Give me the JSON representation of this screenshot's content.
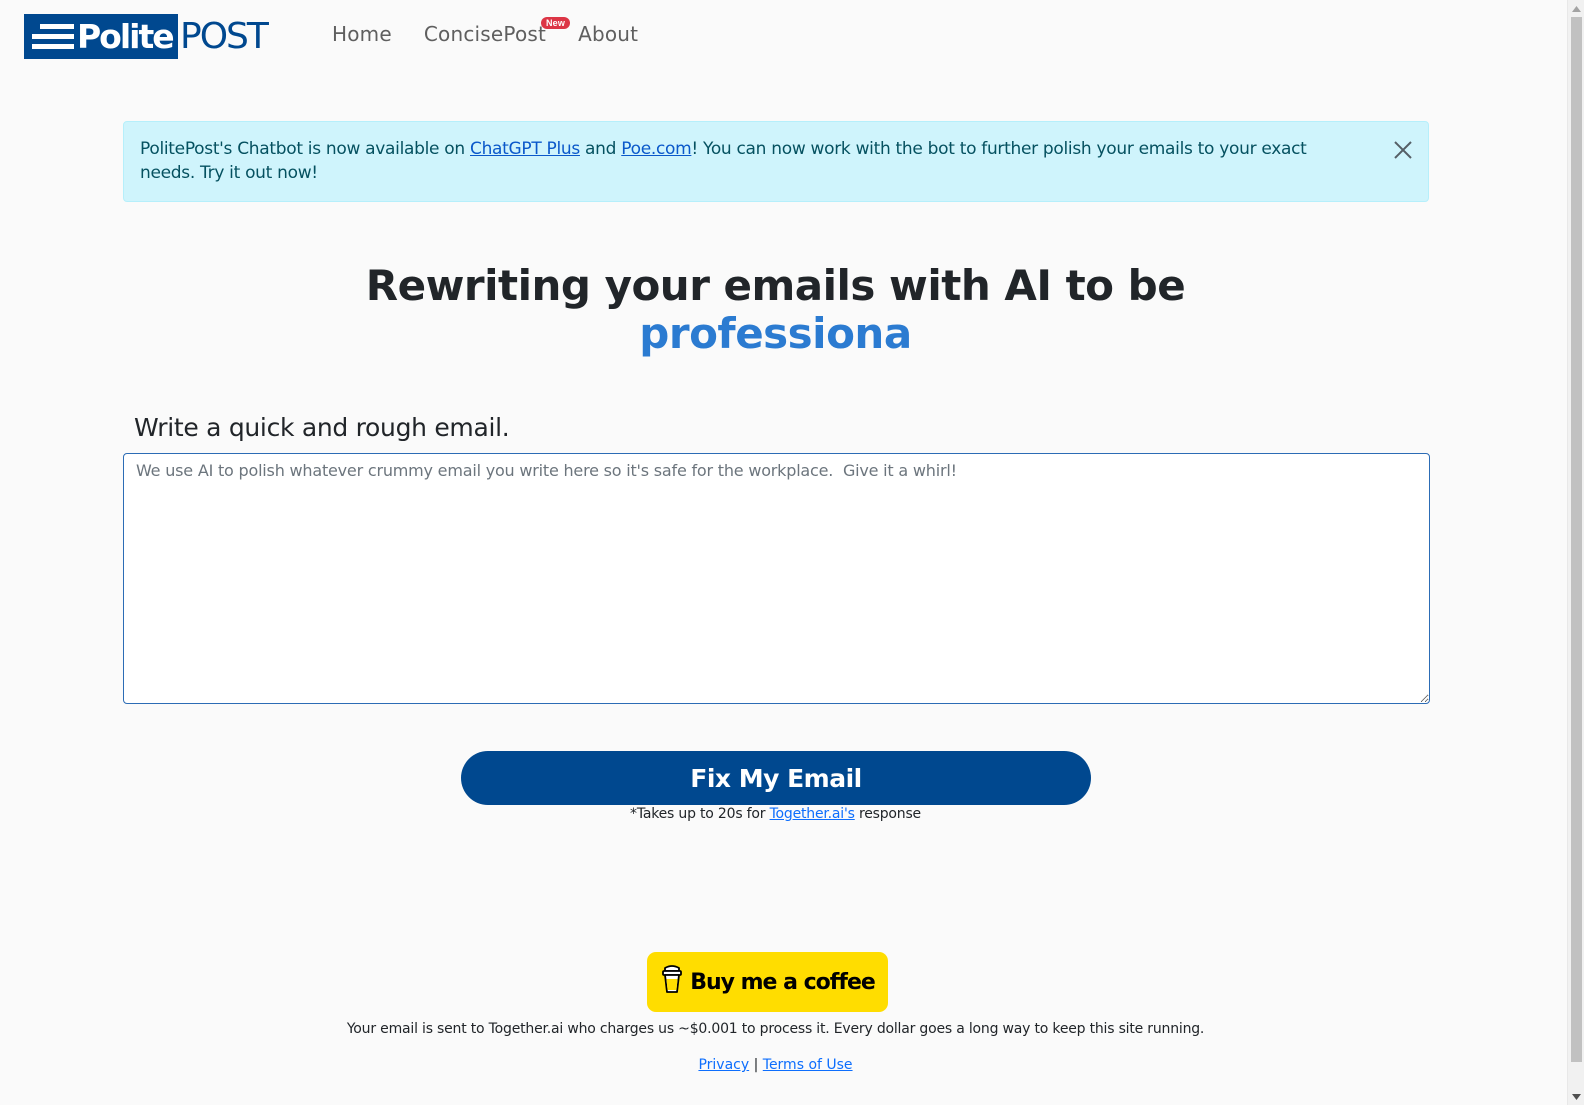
{
  "header": {
    "logo": {
      "part1": "Polite",
      "part2": "POST"
    },
    "nav": [
      {
        "label": "Home"
      },
      {
        "label": "ConcisePost",
        "badge": "New"
      },
      {
        "label": "About"
      }
    ]
  },
  "alert": {
    "text_before": "PolitePost's Chatbot is now available on ",
    "link1": "ChatGPT Plus",
    "text_between": " and ",
    "link2": "Poe.com",
    "text_after": "! You can now work with the bot to further polish your emails to your exact needs. Try it out now!",
    "close_icon": "close-icon"
  },
  "hero": {
    "title": "Rewriting your emails with AI to be",
    "typed_word": "professiona"
  },
  "form": {
    "label": "Write a quick and rough email.",
    "value": "",
    "placeholder": "We use AI to polish whatever crummy email you write here so it's safe for the workplace.  Give it a whirl!",
    "submit_label": "Fix My Email",
    "note_before": "*Takes up to 20s for ",
    "note_link": "Together.ai's",
    "note_after": " response"
  },
  "footer": {
    "coffee_label": "Buy me a coffee",
    "coffee_icon": "coffee-cup-icon",
    "disclaimer": "Your email is sent to Together.ai who charges us ~$0.001 to process it. Every dollar goes a long way to keep this site running.",
    "privacy": "Privacy",
    "separator": "|",
    "terms": "Terms of Use"
  },
  "colors": {
    "brand": "#00488f",
    "accent": "#2b7bd1",
    "alert_bg": "#cff4fc",
    "coffee": "#ffdd00",
    "badge": "#dc3545"
  }
}
